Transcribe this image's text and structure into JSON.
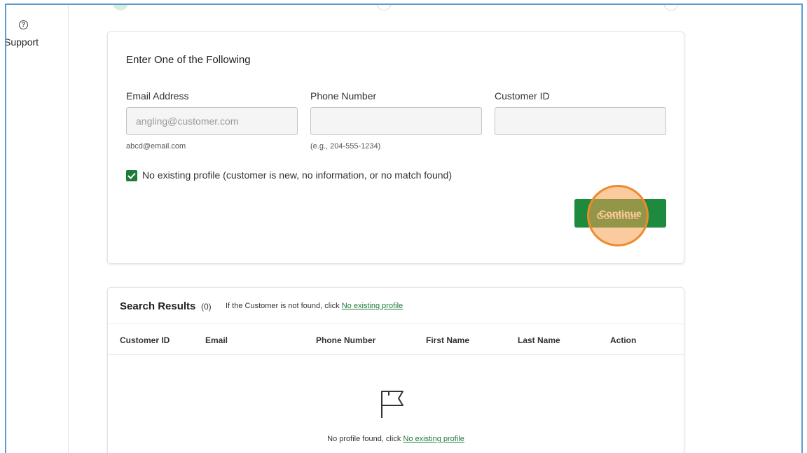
{
  "sidebar": {
    "support_icon": "question-circle-icon",
    "support_icon_glyph": "?",
    "support_label": "Support"
  },
  "search_form": {
    "title": "Enter One of the Following",
    "fields": [
      {
        "label": "Email Address",
        "placeholder": "angling@customer.com",
        "value": "",
        "hint": "abcd@email.com"
      },
      {
        "label": "Phone Number",
        "placeholder": "",
        "value": "",
        "hint": "(e.g., 204-555-1234)"
      },
      {
        "label": "Customer ID",
        "placeholder": "",
        "value": "",
        "hint": ""
      }
    ],
    "no_profile_checkbox": {
      "checked": true,
      "label": "No existing profile (customer is new, no information, or no match found)"
    },
    "continue_label": "Continue"
  },
  "results": {
    "title": "Search Results",
    "count": "(0)",
    "hint_prefix": "If the Customer is not found, click",
    "hint_link": "No existing profile",
    "columns": [
      "Customer ID",
      "Email",
      "Phone Number",
      "First Name",
      "Last Name",
      "Action"
    ],
    "empty_icon": "flag-icon",
    "empty_prefix": "No profile found, click",
    "empty_link": "No existing profile"
  },
  "colors": {
    "accent_green": "#1e8a3e",
    "link_green": "#1e7b3a",
    "click_highlight": "#f0892a",
    "frame_border": "#5b9bd5"
  }
}
